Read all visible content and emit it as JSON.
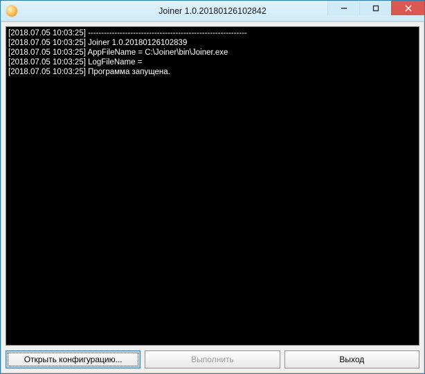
{
  "window": {
    "title": "Joiner 1.0.20180126102842"
  },
  "console": {
    "lines": [
      "[2018.07.05 10:03:25] ------------------------------------------------------------",
      "[2018.07.05 10:03:25] Joiner 1.0.20180126102839",
      "[2018.07.05 10:03:25] AppFileName = C:\\Joiner\\bin\\Joiner.exe",
      "[2018.07.05 10:03:25] LogFileName =",
      "[2018.07.05 10:03:25] Программа запущена."
    ]
  },
  "buttons": {
    "open_config": "Открыть конфигурацию...",
    "execute": "Выполнить",
    "exit": "Выход"
  },
  "colors": {
    "titlebar": "#d0ebf8",
    "close": "#d9584f",
    "client_bg": "#f0f0f0",
    "console_bg": "#000000",
    "console_fg": "#ffffff"
  }
}
